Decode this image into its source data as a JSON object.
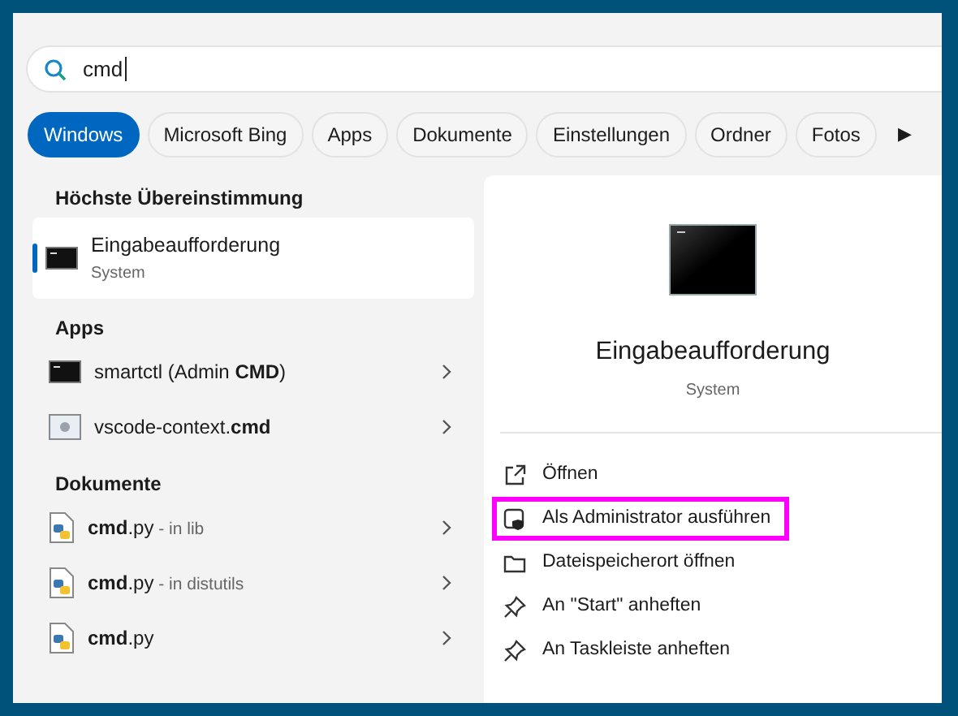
{
  "search": {
    "value": "cmd"
  },
  "filters": [
    {
      "label": "Windows",
      "selected": true
    },
    {
      "label": "Microsoft Bing",
      "selected": false
    },
    {
      "label": "Apps",
      "selected": false
    },
    {
      "label": "Dokumente",
      "selected": false
    },
    {
      "label": "Einstellungen",
      "selected": false
    },
    {
      "label": "Ordner",
      "selected": false
    },
    {
      "label": "Fotos",
      "selected": false
    }
  ],
  "more_filters": "▶",
  "best_match": {
    "heading": "Höchste Übereinstimmung",
    "title": "Eingabeaufforderung",
    "subtitle": "System",
    "selected": true
  },
  "sections": [
    {
      "heading": "Apps",
      "items": [
        {
          "kind": "terminal",
          "name": "smartctl (Admin **CMD**)"
        },
        {
          "kind": "script",
          "name": "vscode-context.**cmd**"
        }
      ]
    },
    {
      "heading": "Dokumente",
      "items": [
        {
          "kind": "python",
          "name": "**cmd**.py",
          "location": " - in lib"
        },
        {
          "kind": "python",
          "name": "**cmd**.py",
          "location": " - in distutils"
        },
        {
          "kind": "python",
          "name": "**cmd**.py"
        }
      ]
    }
  ],
  "details": {
    "title": "Eingabeaufforderung",
    "subtitle": "System",
    "actions": [
      {
        "kind": "open",
        "label": "Öffnen",
        "highlighted": false
      },
      {
        "kind": "admin",
        "label": "Als Administrator ausführen",
        "highlighted": true
      },
      {
        "kind": "folder",
        "label": "Dateispeicherort öffnen",
        "highlighted": false
      },
      {
        "kind": "pin",
        "label": "An \"Start\" anheften",
        "highlighted": false
      },
      {
        "kind": "pin",
        "label": "An Taskleiste anheften",
        "highlighted": false
      }
    ]
  }
}
